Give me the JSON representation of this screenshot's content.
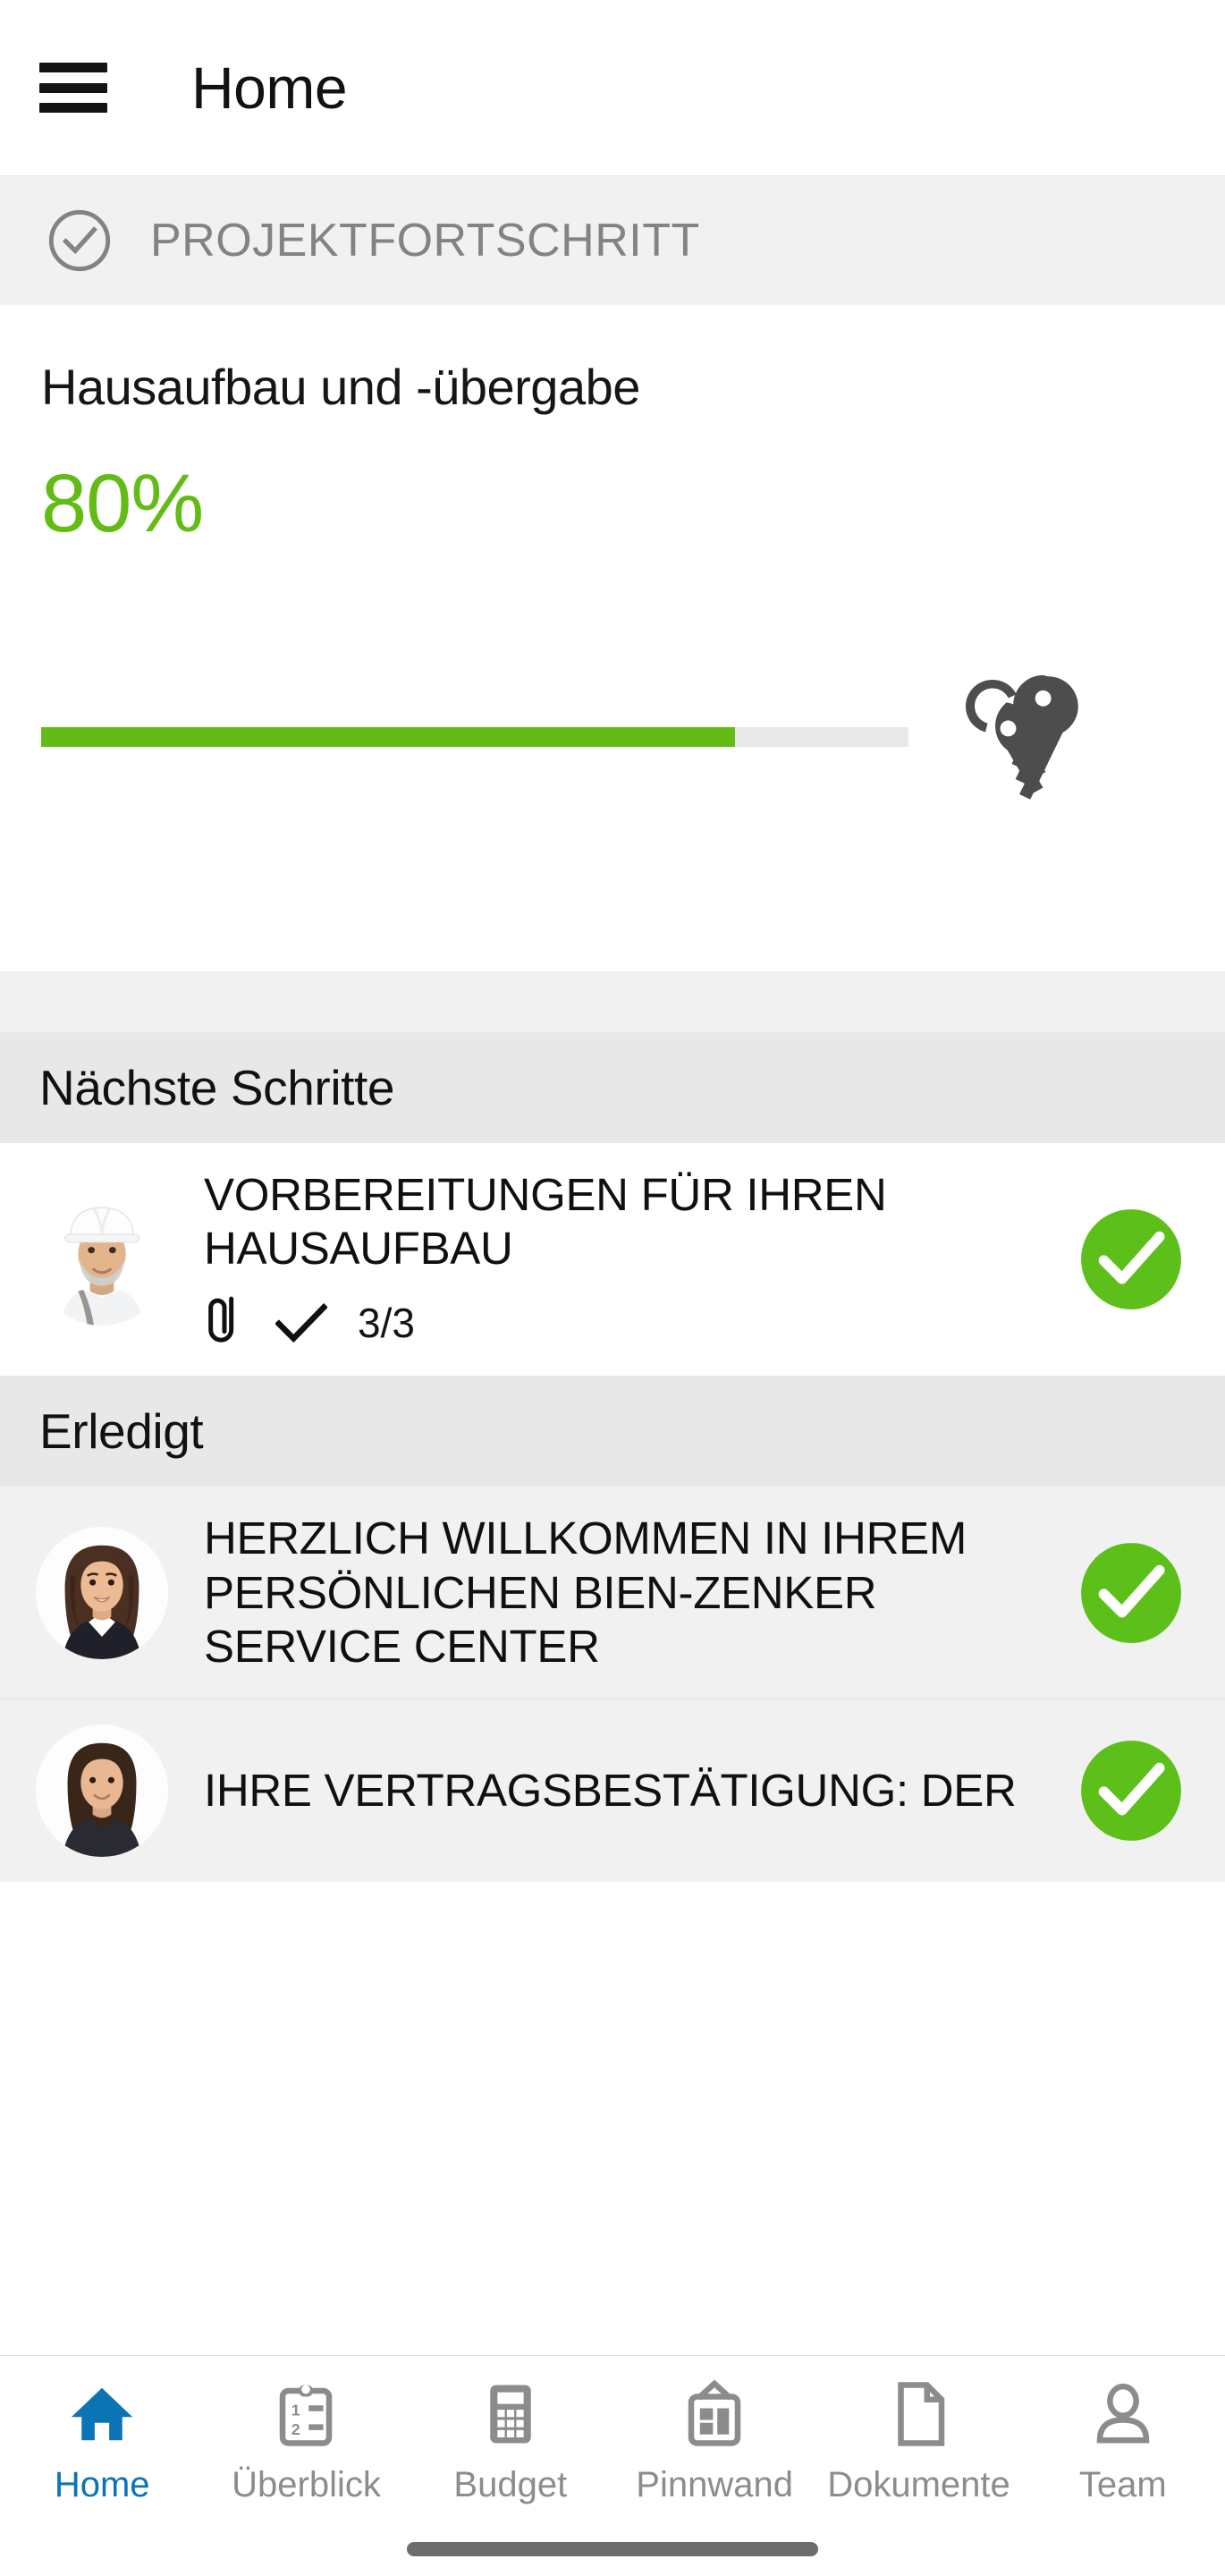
{
  "header": {
    "menu_icon": "hamburger-menu-icon",
    "title": "Home"
  },
  "progress_section": {
    "band_icon": "circle-check-outline-icon",
    "band_label": "PROJEKTFORTSCHRITT",
    "title": "Hausaufbau und -übergabe",
    "percent_label": "80%",
    "percent_value": 80,
    "trailing_icon": "keys-icon",
    "accent_color": "#62bc15",
    "track_color": "#e9e9e9"
  },
  "groups": [
    {
      "label": "Nächste Schritte",
      "items": [
        {
          "avatar": "avatar-construction-manager",
          "title": "VORBEREITUNGEN FÜR IHREN HAUSAUFBAU",
          "attachment_icon": "paperclip-icon",
          "check_icon": "check-icon",
          "count": "3/3",
          "status_badge": "check-circle-filled-icon"
        }
      ]
    },
    {
      "label": "Erledigt",
      "items": [
        {
          "avatar": "avatar-service-consultant",
          "title": "HERZLICH WILLKOMMEN IN IHREM PERSÖNLICHEN BIEN-ZENKER SERVICE CENTER",
          "status_badge": "check-circle-filled-icon"
        },
        {
          "avatar": "avatar-sales-advisor",
          "title": "IHRE VERTRAGSBESTÄTIGUNG: DER",
          "status_badge": "check-circle-filled-icon"
        }
      ]
    }
  ],
  "tabbar": {
    "active_color": "#0c74b5",
    "inactive_color": "#8c8c8c",
    "tabs": [
      {
        "label": "Home",
        "icon": "home-icon",
        "active": true
      },
      {
        "label": "Überblick",
        "icon": "clipboard-list-icon",
        "active": false
      },
      {
        "label": "Budget",
        "icon": "calculator-icon",
        "active": false
      },
      {
        "label": "Pinnwand",
        "icon": "pinboard-icon",
        "active": false
      },
      {
        "label": "Dokumente",
        "icon": "document-icon",
        "active": false
      },
      {
        "label": "Team",
        "icon": "person-icon",
        "active": false
      }
    ]
  }
}
